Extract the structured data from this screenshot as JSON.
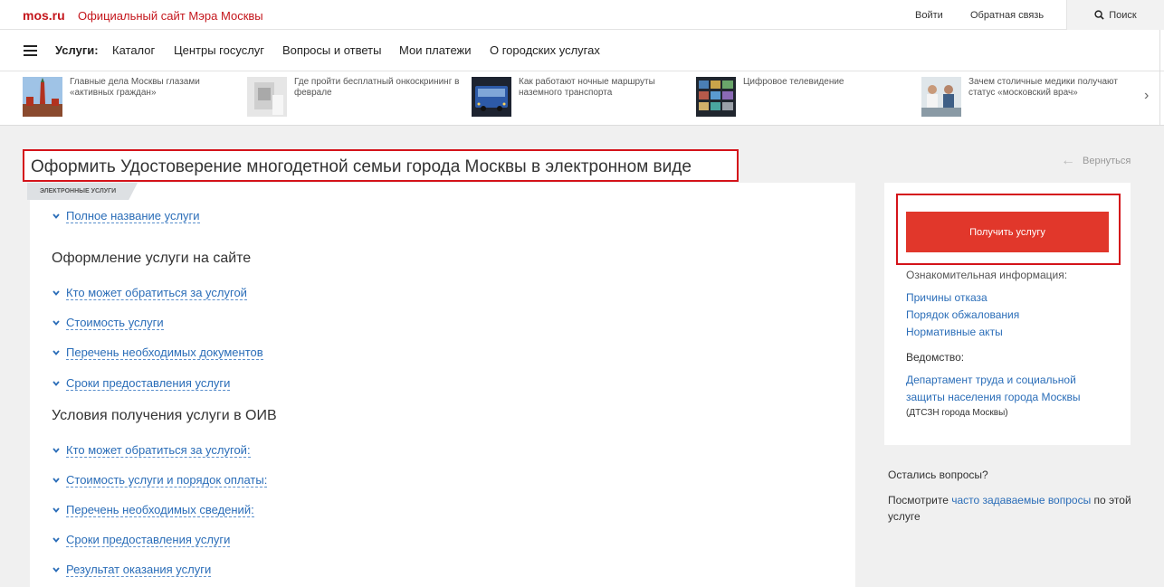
{
  "header": {
    "logo": "mos.ru",
    "site_title": "Официальный сайт Мэра Москвы",
    "login": "Войти",
    "feedback": "Обратная связь",
    "search": "Поиск"
  },
  "nav": {
    "label": "Услуги:",
    "items": [
      "Каталог",
      "Центры госуслуг",
      "Вопросы и ответы",
      "Мои платежи",
      "О городских услугах"
    ]
  },
  "news": [
    {
      "text": "Главные дела Москвы глазами «активных граждан»",
      "thumb": "kremlin-photo"
    },
    {
      "text": "Где пройти бесплатный онкоскрининг в феврале",
      "thumb": "medical-photo"
    },
    {
      "text": "Как работают ночные маршруты наземного транспорта",
      "thumb": "bus-photo"
    },
    {
      "text": "Цифровое телевидение",
      "thumb": "tv-photo"
    },
    {
      "text": "Зачем столичные медики получают статус «московский врач»",
      "thumb": "doctors-photo"
    }
  ],
  "page": {
    "title": "Оформить Удостоверение многодетной семьи города Москвы в электронном виде",
    "back": "Вернуться",
    "tag": "Электронные услуги"
  },
  "accordion": {
    "full_name": "Полное название услуги",
    "section1": "Оформление услуги на сайте",
    "s1_items": [
      "Кто может обратиться за услугой",
      "Стоимость услуги",
      "Перечень необходимых документов",
      "Сроки предоставления услуги"
    ],
    "section2": "Условия получения услуги в ОИВ",
    "s2_items": [
      "Кто может обратиться за услугой:",
      "Стоимость услуги и порядок оплаты:",
      "Перечень необходимых сведений:",
      "Сроки предоставления услуги",
      "Результат оказания услуги"
    ]
  },
  "sidebar": {
    "cta": "Получить услугу",
    "info_label": "Ознакомительная информация:",
    "links": [
      "Причины отказа",
      "Порядок обжалования",
      "Нормативные акты"
    ],
    "dept_label": "Ведомство:",
    "dept_line1": "Департамент труда и социальной",
    "dept_line2": "защиты населения города Москвы",
    "dept_short": "(ДТСЗН города Москвы)"
  },
  "questions": {
    "title": "Остались вопросы?",
    "prefix": "Посмотрите ",
    "link": "часто задаваемые вопросы",
    "suffix": " по этой услуге"
  }
}
